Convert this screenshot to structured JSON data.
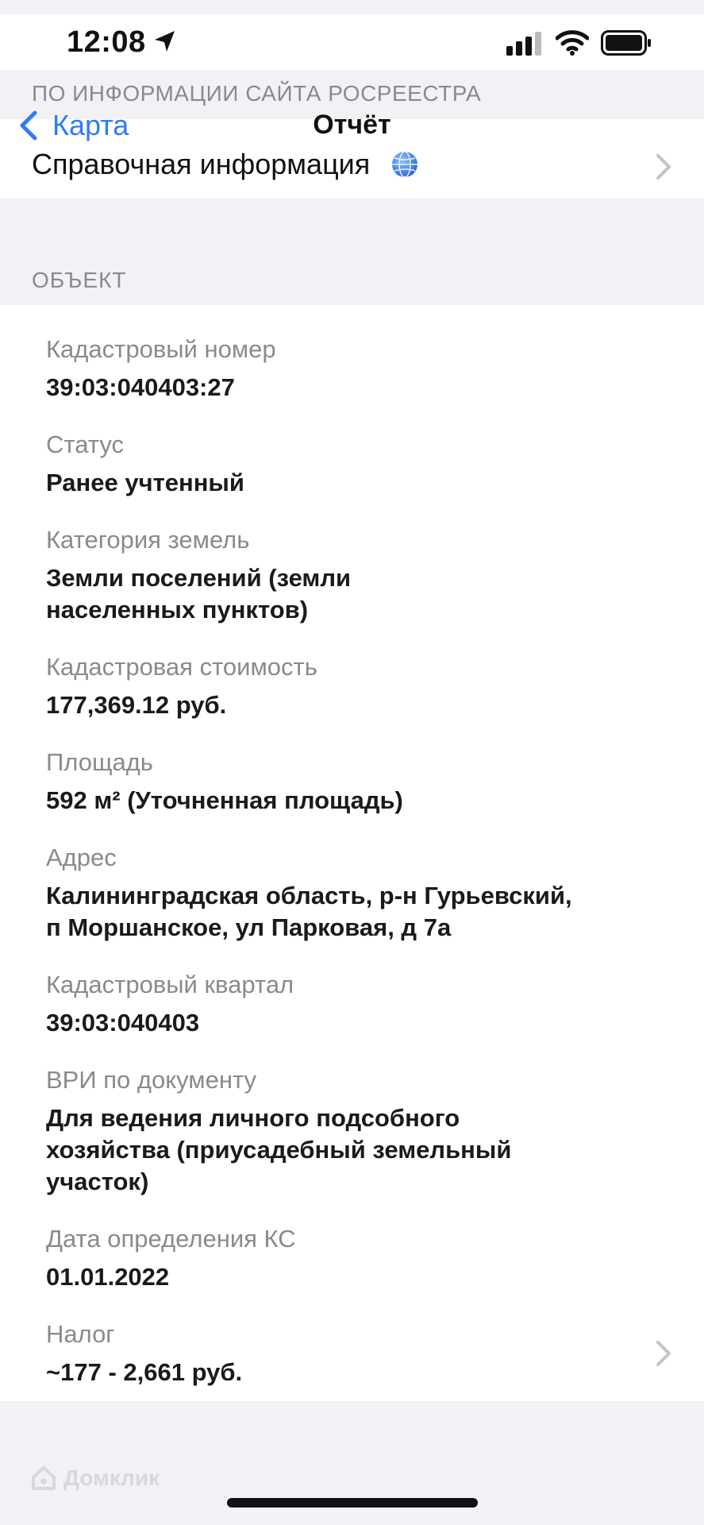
{
  "status_bar": {
    "time": "12:08"
  },
  "top_section_header": "ПО ИНФОРМАЦИИ САЙТА РОСРЕЕСТРА",
  "nav": {
    "back_label": "Карта",
    "title": "Отчёт"
  },
  "reference_row": {
    "label": "Справочная информация"
  },
  "object_section_header": "ОБЪЕКТ",
  "fields": [
    {
      "label": "Кадастровый номер",
      "value": "39:03:040403:27"
    },
    {
      "label": "Статус",
      "value": "Ранее учтенный"
    },
    {
      "label": "Категория земель",
      "value_lines": [
        "Земли поселений (земли",
        "населенных пунктов)"
      ]
    },
    {
      "label": "Кадастровая стоимость",
      "value": "177,369.12 руб."
    },
    {
      "label": "Площадь",
      "value": "592 м² (Уточненная площадь)"
    },
    {
      "label": "Адрес",
      "value_lines": [
        "Калининградская область, р-н Гурьевский,",
        "п Моршанское, ул Парковая, д 7а"
      ]
    },
    {
      "label": "Кадастровый квартал",
      "value": "39:03:040403"
    },
    {
      "label": "ВРИ по документу",
      "value_lines": [
        "Для ведения личного подсобного",
        "хозяйства (приусадебный земельный",
        "участок)"
      ]
    },
    {
      "label": "Дата определения КС",
      "value": "01.01.2022"
    },
    {
      "label": "Налог",
      "value": "~177 - 2,661 руб."
    }
  ],
  "watermark": "Домклик",
  "colors": {
    "accent": "#2f7cf6",
    "secondary_text": "#8a8a8e",
    "background": "#f2f2f6"
  },
  "icons": [
    "location-arrow-icon",
    "cellular-signal-icon",
    "wifi-icon",
    "battery-icon",
    "chevron-left-icon",
    "globe-icon",
    "chevron-right-icon",
    "domclick-logo-icon"
  ]
}
